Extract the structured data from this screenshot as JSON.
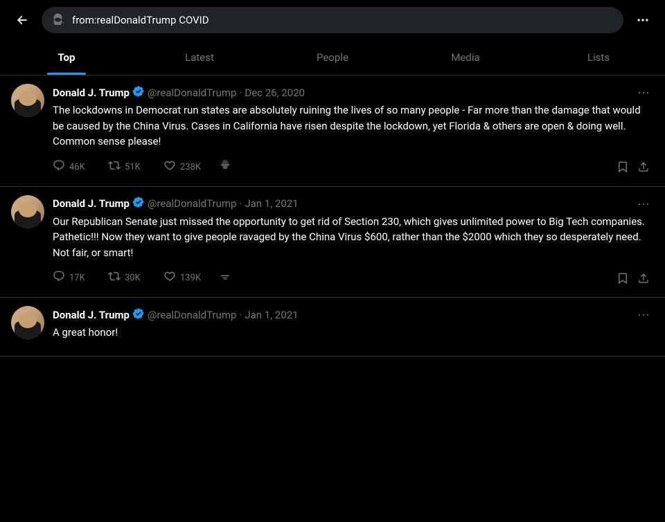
{
  "header": {
    "search_query": "from:realDonaldTrump COVID",
    "more_icon": "•••",
    "back_icon": "←",
    "search_icon": "🔍"
  },
  "tabs": [
    {
      "id": "top",
      "label": "Top",
      "active": true
    },
    {
      "id": "latest",
      "label": "Latest",
      "active": false
    },
    {
      "id": "people",
      "label": "People",
      "active": false
    },
    {
      "id": "media",
      "label": "Media",
      "active": false
    },
    {
      "id": "lists",
      "label": "Lists",
      "active": false
    }
  ],
  "tweets": [
    {
      "id": "tweet1",
      "username": "Donald J. Trump",
      "handle": "@realDonaldTrump",
      "date": "Dec 26, 2020",
      "text": "The lockdowns in Democrat run states are absolutely ruining the lives of so many people - Far more than the damage that would be caused by the China Virus. Cases in California have risen despite the lockdown, yet Florida & others are open & doing well. Common sense please!",
      "actions": {
        "reply": {
          "label": "46K"
        },
        "retweet": {
          "label": "51K"
        },
        "like": {
          "label": "238K"
        },
        "views": {
          "label": ""
        }
      }
    },
    {
      "id": "tweet2",
      "username": "Donald J. Trump",
      "handle": "@realDonaldTrump",
      "date": "Jan 1, 2021",
      "text": "Our Republican Senate just missed the opportunity to get rid of Section 230, which gives unlimited power to Big Tech companies. Pathetic!!! Now they want to give people ravaged by the China Virus $600, rather than the $2000 which they so desperately need. Not fair, or smart!",
      "actions": {
        "reply": {
          "label": "17K"
        },
        "retweet": {
          "label": "30K"
        },
        "like": {
          "label": "139K"
        },
        "views": {
          "label": ""
        }
      }
    },
    {
      "id": "tweet3",
      "username": "Donald J. Trump",
      "handle": "@realDonaldTrump",
      "date": "Jan 1, 2021",
      "text": "A great honor!",
      "actions": {
        "reply": {
          "label": ""
        },
        "retweet": {
          "label": ""
        },
        "like": {
          "label": ""
        },
        "views": {
          "label": ""
        }
      }
    }
  ],
  "accent_color": "#1d9bf0"
}
